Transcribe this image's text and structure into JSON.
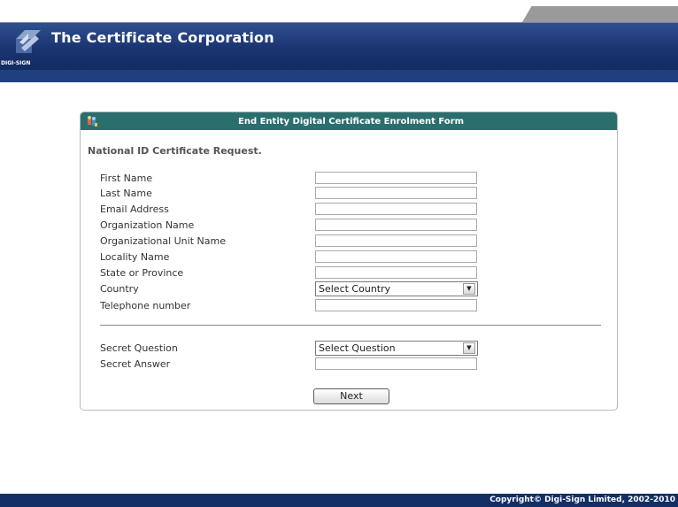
{
  "header": {
    "brand": "The Certificate Corporation",
    "logo_caption": "DIGI-SIGN"
  },
  "form": {
    "title": "End Entity Digital Certificate Enrolment Form",
    "subtitle": "National ID Certificate Request.",
    "fields": [
      {
        "label": "First Name",
        "value": ""
      },
      {
        "label": "Last Name",
        "value": ""
      },
      {
        "label": "Email Address",
        "value": ""
      },
      {
        "label": "Organization Name",
        "value": ""
      },
      {
        "label": "Organizational Unit Name",
        "value": ""
      },
      {
        "label": "Locality Name",
        "value": ""
      },
      {
        "label": "State or Province",
        "value": ""
      },
      {
        "label": "Country",
        "selected": "Select Country"
      },
      {
        "label": "Telephone number",
        "value": ""
      }
    ],
    "secret": [
      {
        "label": "Secret Question",
        "selected": "Select Question"
      },
      {
        "label": "Secret Answer",
        "value": ""
      }
    ],
    "next_label": "Next"
  },
  "footer": {
    "copyright": "Copyright© Digi-Sign Limited, 2002-2010"
  },
  "colors": {
    "header_bg": "#1a3470",
    "form_header_bg": "#2b6e6e",
    "footer_bg": "#132f66"
  }
}
